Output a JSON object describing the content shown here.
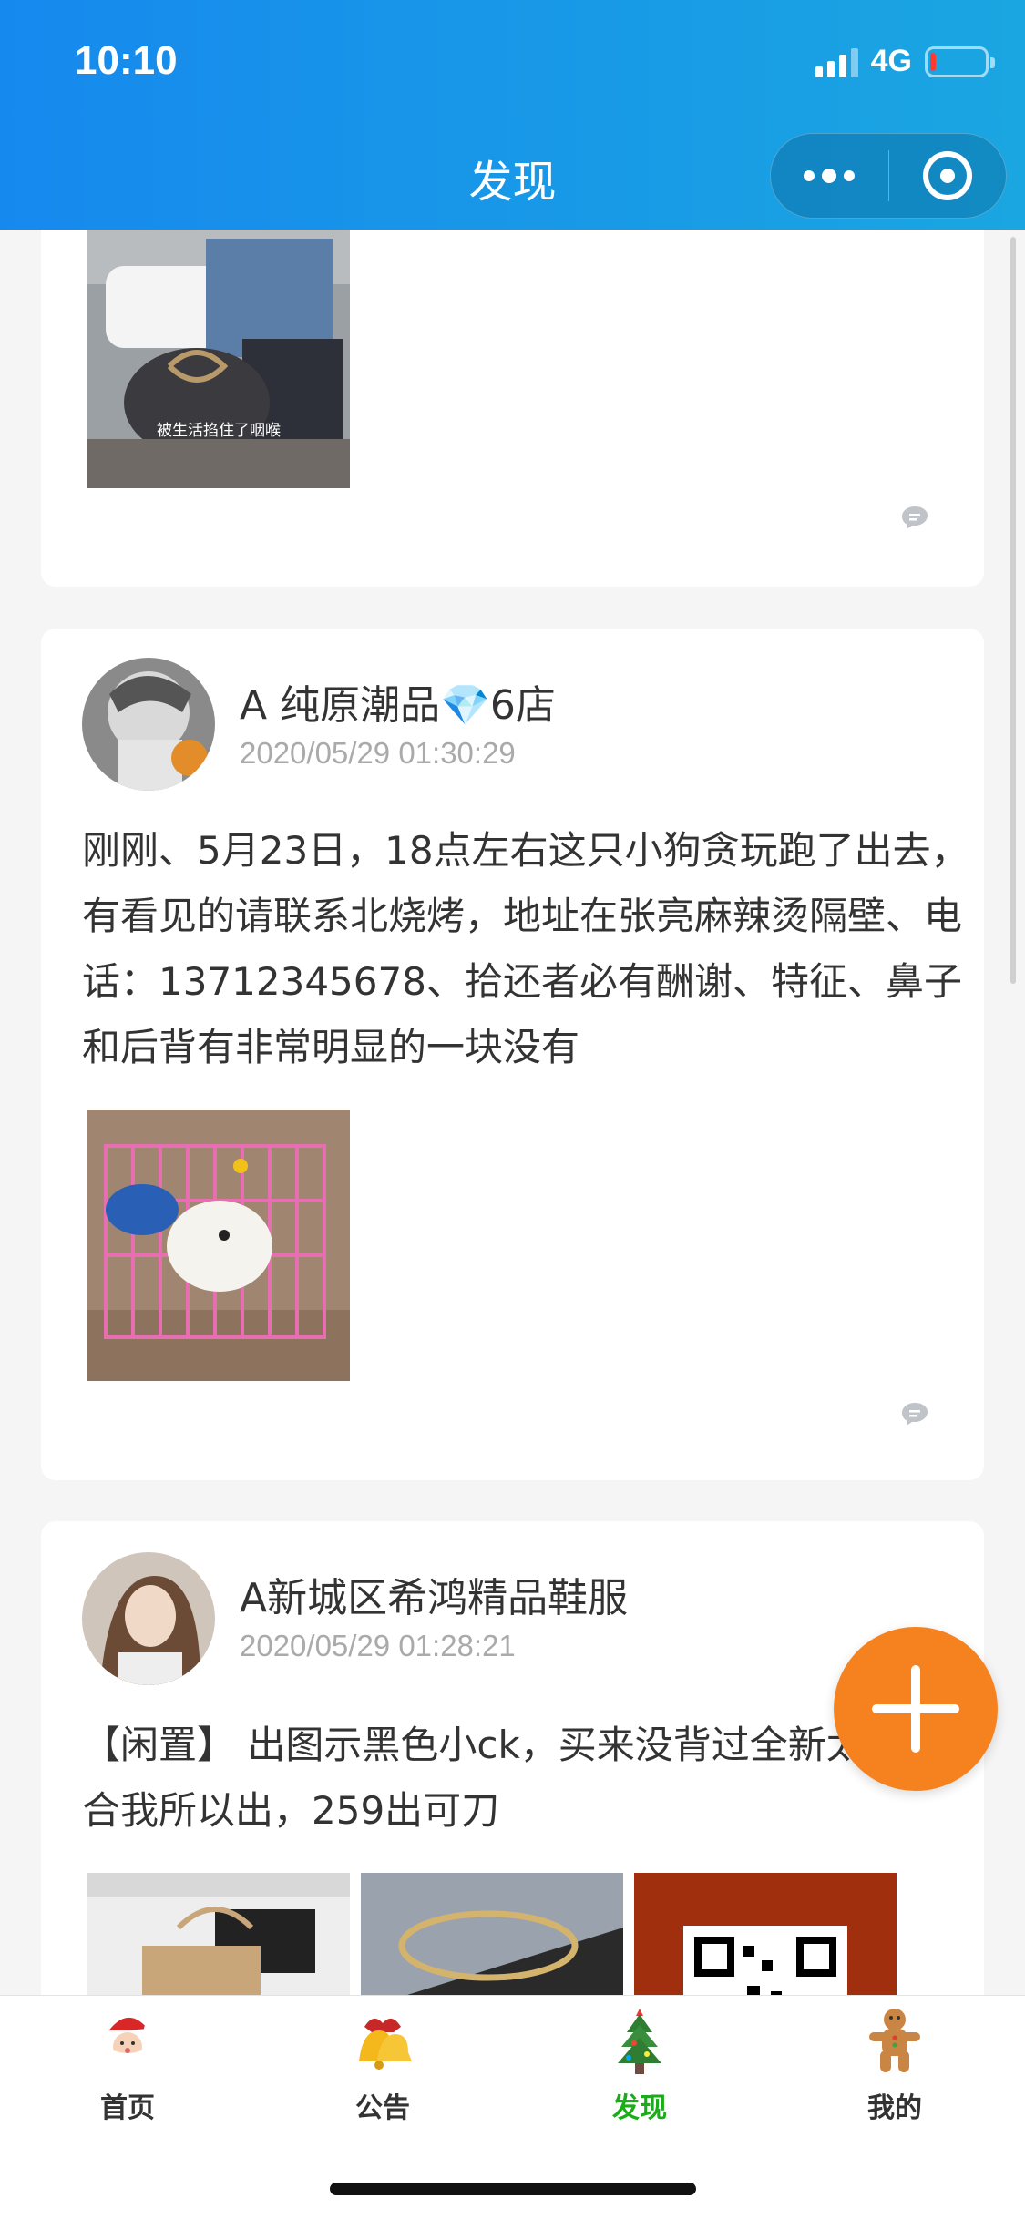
{
  "status_bar": {
    "time": "10:10",
    "network": "4G"
  },
  "header": {
    "title": "发现"
  },
  "posts": [
    {
      "image_caption": "被生活掐住了咽喉"
    },
    {
      "user": "A 纯原潮品💎6店",
      "time": "2020/05/29 01:30:29",
      "text": "刚刚、5月23日，18点左右这只小狗贪玩跑了出去，有看见的请联系北烧烤，地址在张亮麻辣烫隔壁、电话：13712345678、拾还者必有酬谢、特征、鼻子和后背有非常明显的一块没有"
    },
    {
      "user": "A新城区希鸿精品鞋服",
      "time": "2020/05/29 01:28:21",
      "text": "【闲置】 出图示黑色小ck，买来没背过全新太小不适合我所以出，259出可刀"
    }
  ],
  "tabbar": {
    "items": [
      {
        "label": "首页",
        "icon": "santa-icon"
      },
      {
        "label": "公告",
        "icon": "bell-icon"
      },
      {
        "label": "发现",
        "icon": "christmas-tree-icon"
      },
      {
        "label": "我的",
        "icon": "gingerbread-icon"
      }
    ],
    "active_index": 2
  },
  "colors": {
    "header": "#1a94e8",
    "fab": "#f5811f",
    "active_tab": "#1aad19"
  }
}
